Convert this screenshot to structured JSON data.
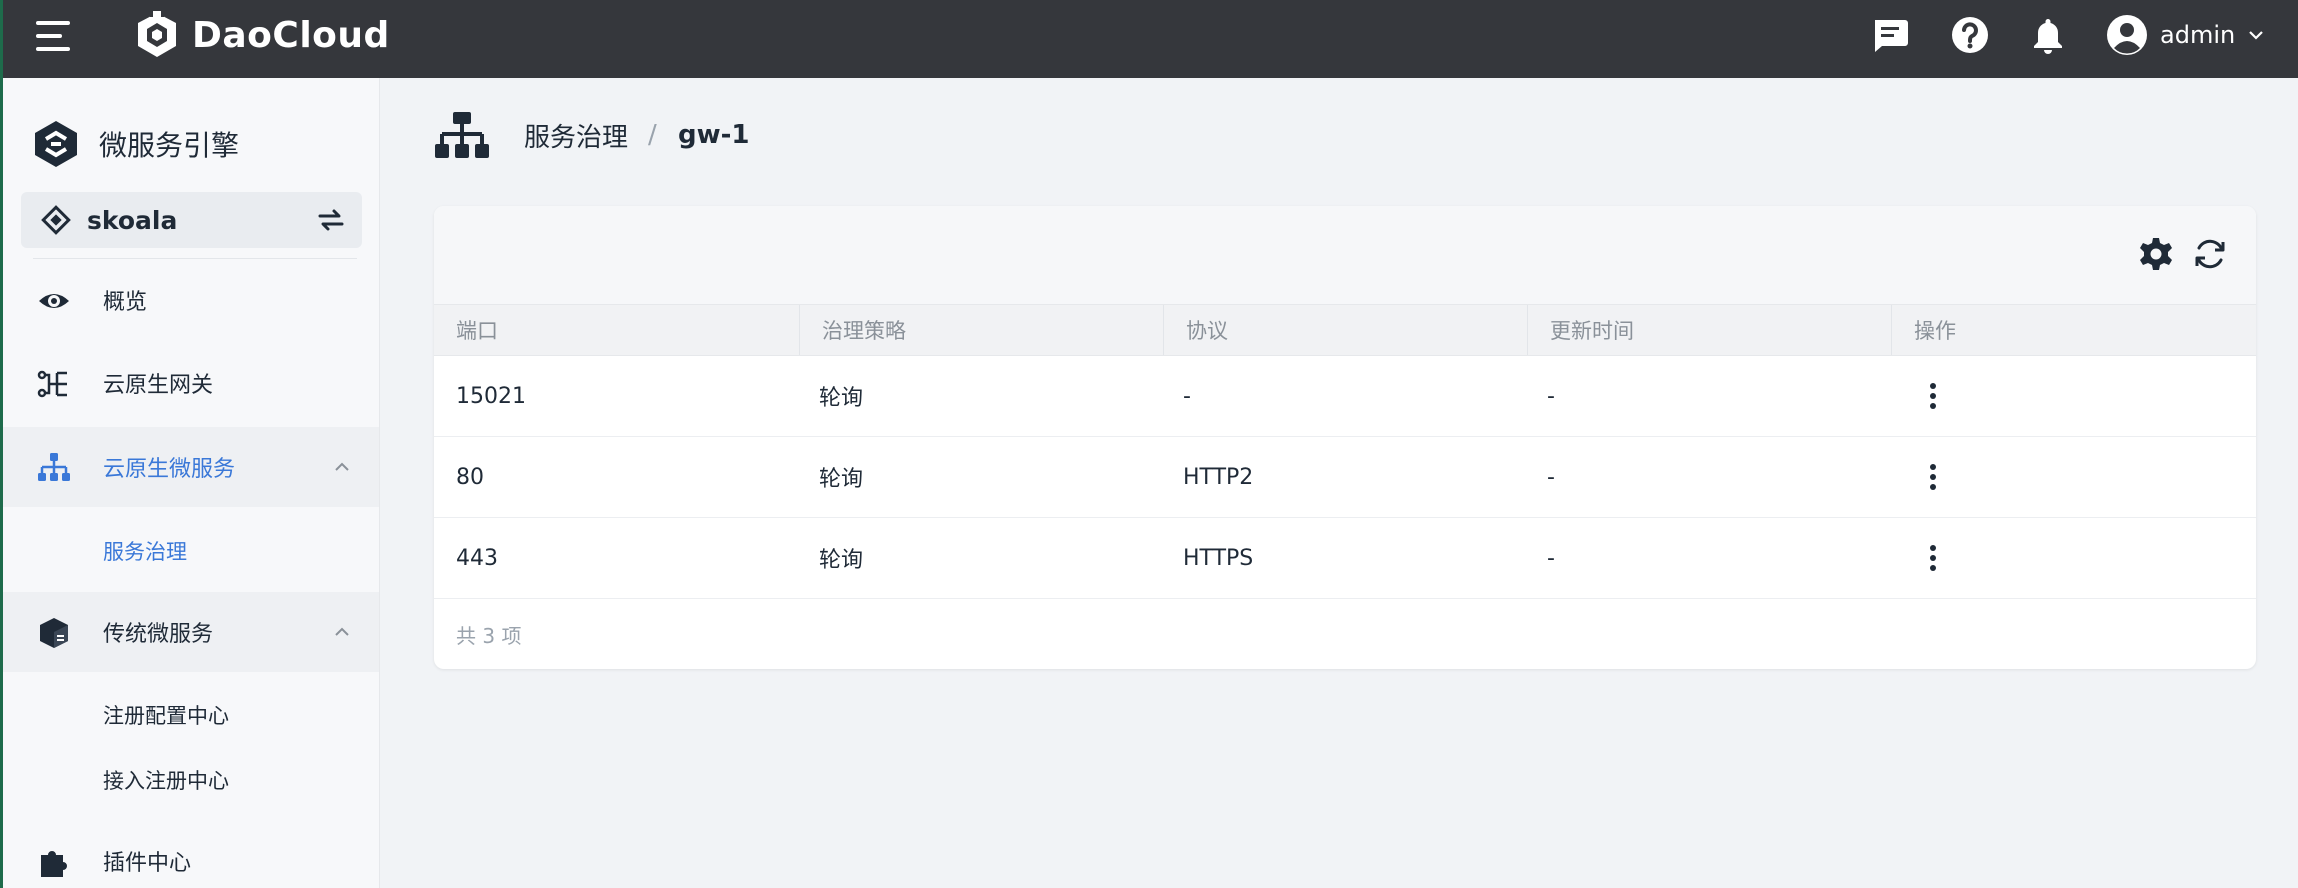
{
  "header": {
    "brand": "DaoCloud",
    "user": "admin"
  },
  "sidebar": {
    "app_title": "微服务引擎",
    "workspace": "skoala",
    "items": [
      {
        "label": "概览"
      },
      {
        "label": "云原生网关"
      },
      {
        "label": "云原生微服务"
      },
      {
        "label": "传统微服务"
      },
      {
        "label": "插件中心"
      }
    ],
    "sub_cloud": [
      {
        "label": "服务治理"
      }
    ],
    "sub_traditional": [
      {
        "label": "注册配置中心"
      },
      {
        "label": "接入注册中心"
      }
    ]
  },
  "breadcrumb": {
    "parent": "服务治理",
    "separator": "/",
    "current": "gw-1"
  },
  "table": {
    "columns": [
      "端口",
      "治理策略",
      "协议",
      "更新时间",
      "操作"
    ],
    "rows": [
      {
        "port": "15021",
        "policy": "轮询",
        "protocol": "-",
        "updated": "-"
      },
      {
        "port": "80",
        "policy": "轮询",
        "protocol": "HTTP2",
        "updated": "-"
      },
      {
        "port": "443",
        "policy": "轮询",
        "protocol": "HTTPS",
        "updated": "-"
      }
    ],
    "total": "共 3 项"
  },
  "colors": {
    "topbar": "#35373c",
    "accent": "#3a78d8",
    "icon_dark": "#1f2a37"
  },
  "icons": [
    "menu-icon",
    "daocloud-logo-icon",
    "feedback-icon",
    "help-icon",
    "bell-icon",
    "user-avatar-icon",
    "chevron-down-icon",
    "engine-logo-icon",
    "workspace-icon",
    "swap-icon",
    "eye-icon",
    "gateway-icon",
    "hierarchy-icon",
    "cube-icon",
    "puzzle-icon",
    "chevron-up-icon",
    "settings-icon",
    "refresh-icon",
    "more-vertical-icon"
  ]
}
